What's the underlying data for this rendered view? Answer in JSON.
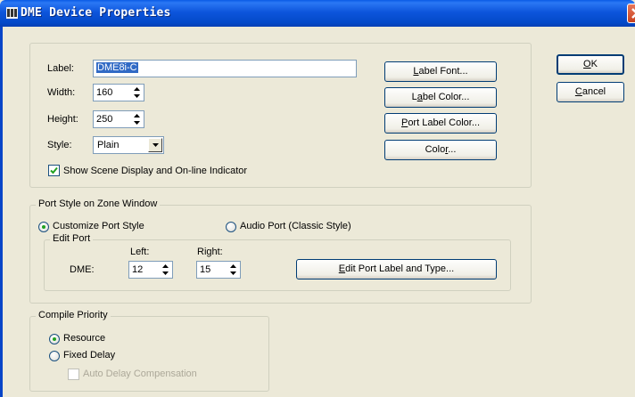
{
  "window": {
    "title": "DME Device Properties"
  },
  "properties": {
    "label_caption": "Label:",
    "label_value": "DME8i-C",
    "width_caption": "Width:",
    "width_value": "160",
    "height_caption": "Height:",
    "height_value": "250",
    "style_caption": "Style:",
    "style_value": "Plain",
    "show_scene_label": "Show Scene Display and On-line Indicator",
    "show_scene_checked": true
  },
  "buttons": {
    "label_font": {
      "pre": "",
      "u": "L",
      "post": "abel Font..."
    },
    "label_color": {
      "pre": "L",
      "u": "a",
      "post": "bel Color..."
    },
    "port_label_color": {
      "pre": "",
      "u": "P",
      "post": "ort Label Color..."
    },
    "color": {
      "pre": "Colo",
      "u": "r",
      "post": "..."
    },
    "ok": {
      "pre": "",
      "u": "O",
      "post": "K"
    },
    "cancel": {
      "pre": "",
      "u": "C",
      "post": "ancel"
    },
    "edit_port": {
      "pre": "",
      "u": "E",
      "post": "dit Port Label and Type..."
    }
  },
  "port_style": {
    "title": "Port Style on Zone Window",
    "customize_label": "Customize Port Style",
    "audio_label": "Audio Port (Classic Style)",
    "edit_port_title": "Edit Port",
    "left_caption": "Left:",
    "right_caption": "Right:",
    "dme_caption": "DME:",
    "left_value": "12",
    "right_value": "15"
  },
  "compile": {
    "title": "Compile Priority",
    "resource_label": "Resource",
    "fixed_delay_label": "Fixed Delay",
    "auto_delay_label": "Auto Delay Compensation"
  },
  "colors": {
    "titlebar": "#0a5ae6",
    "dialog_bg": "#ece9d8",
    "selection": "#316ac5",
    "radio_dot": "#21a121",
    "check_mark": "#21a121"
  },
  "icons": {
    "title": "app-icon",
    "close": "close-icon",
    "spin_up": "spin-up-icon",
    "spin_down": "spin-down-icon",
    "dropdown": "chevron-down-icon"
  }
}
